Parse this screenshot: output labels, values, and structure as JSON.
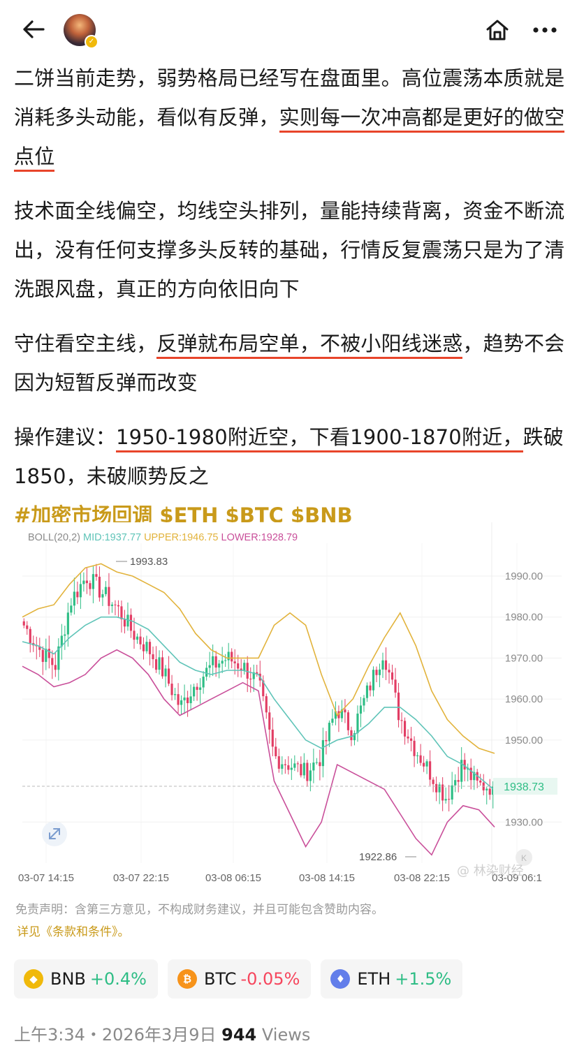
{
  "header": {
    "back_icon": "arrow-left-icon",
    "home_icon": "home-icon",
    "more_icon": "more-horizontal-icon",
    "verified_icon": "verified-badge-icon"
  },
  "post": {
    "p1_a": "二饼当前走势，弱势格局已经写在盘面里。高位震荡本质就是消耗多头动能，看似有反弹，",
    "p1_b": "实则每一次冲高都是更好的做空点位",
    "p2": "技术面全线偏空，均线空头排列，量能持续背离，资金不断流出，没有任何支撑多头反转的基础，行情反复震荡只是为了清洗跟风盘，真正的方向依旧向下",
    "p3_a": "守住看空主线，",
    "p3_b": "反弹就布局空单，不被小阳线迷惑",
    "p3_c": "，趋势不会因为短暂反弹而改变",
    "p4_a": "操作建议：",
    "p4_b": "1950-1980附近空，下看1900-1870附近，",
    "p4_c": "跌破1850，未破顺势反之",
    "hashtags": "#加密市场回调 $ETH $BTC $BNB"
  },
  "chart": {
    "indicator_name": "BOLL(20,2)",
    "mid": "MID:1937.77",
    "upper": "UPPER:1946.75",
    "lower": "LOWER:1928.79",
    "high_label": "1993.83",
    "low_label": "1922.86",
    "last_price": "1938.73",
    "watermark": "@ 林染财经",
    "expand_icon": "expand-icon",
    "colors": {
      "mid": "#5fc4b8",
      "upper": "#e2b33c",
      "lower": "#c94f9a",
      "up": "#2ebd85",
      "down": "#e23d64"
    }
  },
  "chart_data": {
    "type": "candlestick",
    "y_ticks": [
      "1990.00",
      "1980.00",
      "1970.00",
      "1960.00",
      "1950.00",
      "1930.00"
    ],
    "x_ticks": [
      "03-07 14:15",
      "03-07 22:15",
      "03-08 06:15",
      "03-08 14:15",
      "03-08 22:15",
      "03-09 06:1"
    ],
    "ylim": [
      1920,
      1998
    ],
    "close_anchors": [
      1978,
      1972,
      1968,
      1984,
      1990,
      1986,
      1982,
      1976,
      1972,
      1966,
      1958,
      1964,
      1968,
      1970,
      1968,
      1964,
      1946,
      1944,
      1942,
      1946,
      1958,
      1952,
      1962,
      1972,
      1956,
      1948,
      1942,
      1936,
      1944,
      1939,
      1938.73
    ],
    "series": [
      {
        "name": "MID",
        "values": [
          1974,
          1973,
          1971,
          1975,
          1978,
          1980,
          1980,
          1979,
          1977,
          1973,
          1969,
          1967,
          1966,
          1967,
          1967,
          1966,
          1960,
          1955,
          1950,
          1948,
          1950,
          1951,
          1954,
          1958,
          1958,
          1955,
          1951,
          1946,
          1944,
          1941,
          1937.77
        ]
      },
      {
        "name": "UPPER",
        "values": [
          1980,
          1982,
          1983,
          1988,
          1992,
          1993,
          1991,
          1990,
          1988,
          1986,
          1982,
          1976,
          1972,
          1970,
          1970,
          1970,
          1978,
          1981,
          1978,
          1966,
          1956,
          1960,
          1968,
          1975,
          1981,
          1973,
          1962,
          1955,
          1951,
          1948,
          1946.75
        ]
      },
      {
        "name": "LOWER",
        "values": [
          1968,
          1966,
          1963,
          1964,
          1966,
          1970,
          1972,
          1970,
          1966,
          1960,
          1956,
          1958,
          1960,
          1962,
          1964,
          1962,
          1940,
          1932,
          1924,
          1930,
          1944,
          1942,
          1940,
          1938,
          1932,
          1926,
          1922,
          1930,
          1934,
          1933,
          1928.79
        ]
      }
    ]
  },
  "disclaimer": "免责声明：含第三方意见，不构成财务建议，并且可能包含赞助内容。",
  "terms": "详见《条款和条件》。",
  "tickers": [
    {
      "symbol": "BNB",
      "change": "+0.4%",
      "icon": "bnb-coin-icon",
      "color": "#f0b90b"
    },
    {
      "symbol": "BTC",
      "change": "-0.05%",
      "icon": "btc-coin-icon",
      "color": "#f7931a"
    },
    {
      "symbol": "ETH",
      "change": "+1.5%",
      "icon": "eth-coin-icon",
      "color": "#627eea"
    }
  ],
  "footer": {
    "time": "上午3:34・2026年3月9日",
    "views_count": "944",
    "views_label": "Views"
  }
}
